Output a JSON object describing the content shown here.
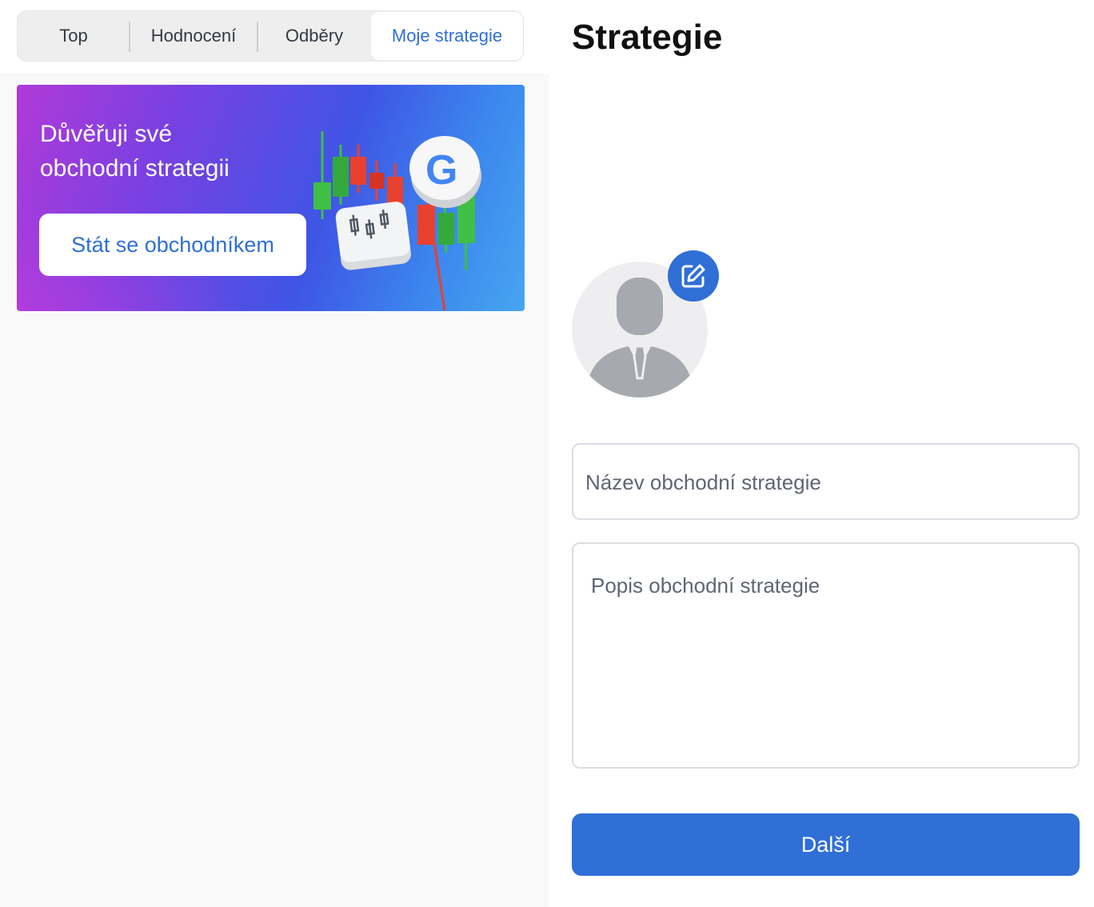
{
  "tabs": [
    {
      "label": "Top",
      "active": false
    },
    {
      "label": "Hodnocení",
      "active": false
    },
    {
      "label": "Odběry",
      "active": false
    },
    {
      "label": "Moje strategie",
      "active": true
    }
  ],
  "banner": {
    "line1": "Důvěřuji své",
    "line2": "obchodní strategii",
    "button_label": "Stát se obchodníkem",
    "art": "candlestick-with-google-coin-illustration"
  },
  "strategy_form": {
    "title": "Strategie",
    "avatar_icon": "person-placeholder-icon",
    "edit_icon": "edit-icon",
    "name_placeholder": "Název obchodní strategie",
    "description_placeholder": "Popis obchodní strategie",
    "next_label": "Další"
  },
  "colors": {
    "accent": "#2f6fd6",
    "banner_gradient_start": "#b03ad8",
    "banner_gradient_end": "#47a5f0",
    "candle_up": "#3fbf46",
    "candle_down": "#e8412f"
  }
}
